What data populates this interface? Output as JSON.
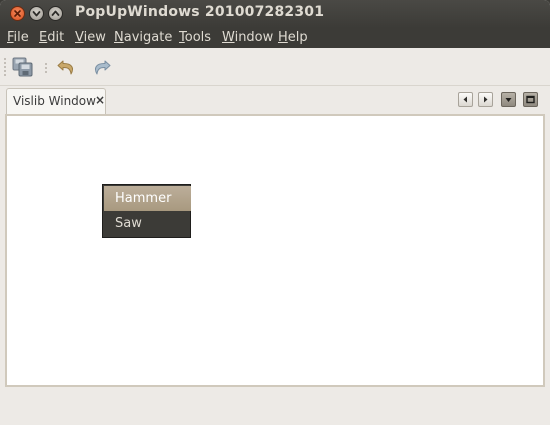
{
  "window": {
    "title": "PopUpWindows 201007282301"
  },
  "menubar": {
    "items": [
      {
        "accel": "F",
        "rest": "ile"
      },
      {
        "accel": "E",
        "rest": "dit"
      },
      {
        "accel": "V",
        "rest": "iew"
      },
      {
        "accel": "N",
        "rest": "avigate"
      },
      {
        "accel": "T",
        "rest": "ools"
      },
      {
        "accel": "W",
        "rest": "indow"
      },
      {
        "accel": "H",
        "rest": "elp"
      }
    ]
  },
  "toolbar": {
    "buttons": [
      "save-all-icon",
      "undo-icon",
      "redo-icon"
    ]
  },
  "tabs": {
    "active": {
      "label": "Vislib Window",
      "close_glyph": "×"
    },
    "nav_icons": [
      "scroll-left-icon",
      "scroll-right-icon",
      "tab-list-icon",
      "maximize-window-icon"
    ]
  },
  "popup": {
    "items": [
      "Hammer",
      "Saw"
    ],
    "selected_index": 0
  },
  "colors": {
    "titlebar": "#3c3b37",
    "menu_text": "#dfdbd2",
    "popup_selected": "#b0a38c",
    "window_bg": "#edeae6"
  }
}
